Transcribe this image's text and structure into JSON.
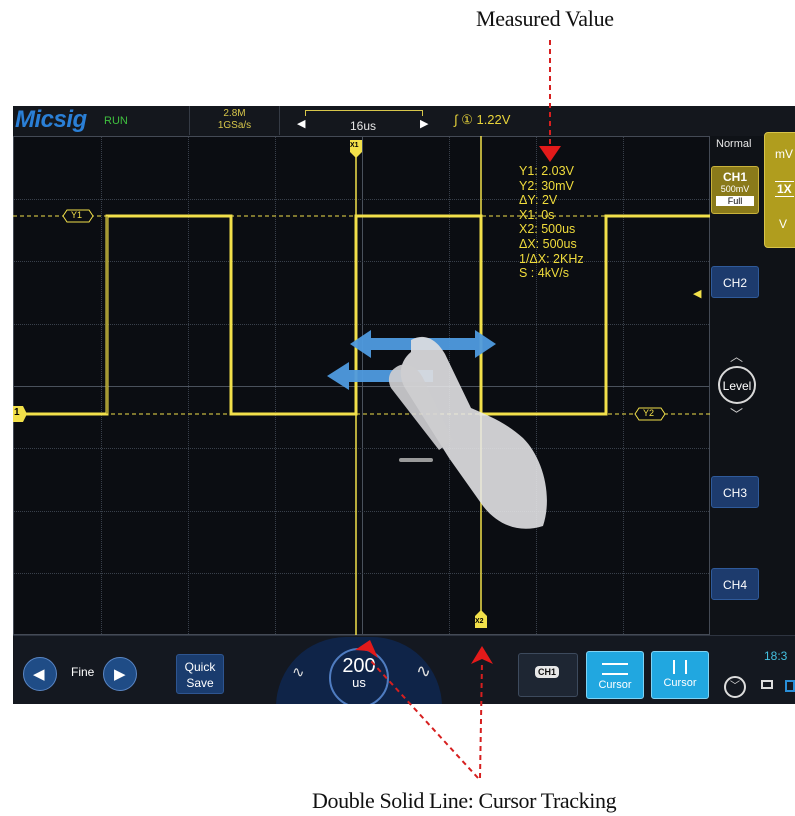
{
  "annotations": {
    "top_label": "Measured Value",
    "bottom_label": "Double Solid Line: Cursor Tracking"
  },
  "header": {
    "brand": "Micsig",
    "run_state": "RUN",
    "memory_depth": "2.8M",
    "sample_rate": "1GSa/s",
    "timebase": "16us",
    "trigger_channel": "①",
    "trigger_level": "1.22V"
  },
  "grid_markers": {
    "x1": "X1",
    "x2": "X2",
    "y1": "Y1",
    "y2": "Y2",
    "ch1_marker": "1"
  },
  "measurements": [
    "Y1:  2.03V",
    "Y2:  30mV",
    "ΔY:  2V",
    "X1:  0s",
    "X2:  500us",
    "ΔX:  500us",
    "1/ΔX:  2KHz",
    "S :  4kV/s"
  ],
  "right_panel": {
    "mode": "Normal",
    "ch1_label": "CH1",
    "ch1_scale": "500mV",
    "ch1_bw": "Full",
    "ch2": "CH2",
    "level": "Level",
    "ch3": "CH3",
    "ch4": "CH4",
    "mv_unit": "mV",
    "probe": "1X",
    "v_unit": "V"
  },
  "bottom_bar": {
    "fine": "Fine",
    "quick_save_line1": "Quick",
    "quick_save_line2": "Save",
    "knob_value": "200",
    "knob_unit": "us",
    "ch1_chip": "CH1",
    "cursor_h": "Cursor",
    "cursor_v": "Cursor",
    "clock": "18:3"
  },
  "colors": {
    "trace": "#f2e04a",
    "annotation_red": "#d61f1f",
    "accent_blue": "#21a7e0"
  }
}
